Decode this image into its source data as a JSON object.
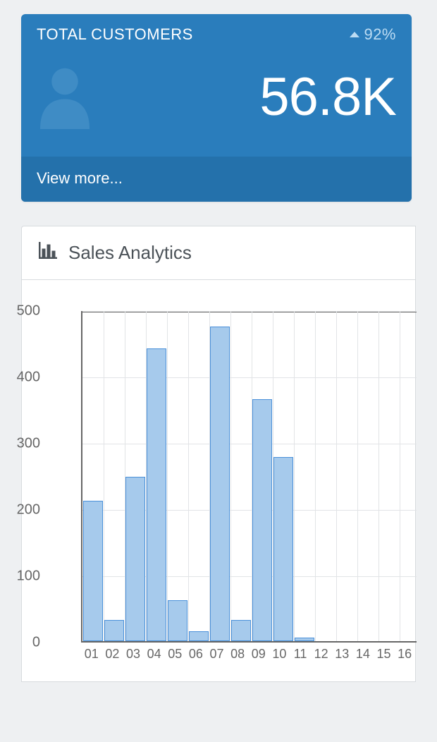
{
  "card": {
    "title": "TOTAL CUSTOMERS",
    "percent": "92%",
    "value": "56.8K",
    "footer": "View more..."
  },
  "panel": {
    "title": "Sales Analytics"
  },
  "chart_data": {
    "type": "bar",
    "title": "Sales Analytics",
    "xlabel": "",
    "ylabel": "",
    "ylim": [
      0,
      500
    ],
    "yticks": [
      0,
      100,
      200,
      300,
      400,
      500
    ],
    "categories": [
      "01",
      "02",
      "03",
      "04",
      "05",
      "06",
      "07",
      "08",
      "09",
      "10",
      "11",
      "12",
      "13",
      "14",
      "15",
      "16"
    ],
    "values": [
      212,
      32,
      248,
      442,
      62,
      15,
      475,
      32,
      365,
      278,
      5,
      0,
      0,
      0,
      0,
      0
    ]
  }
}
